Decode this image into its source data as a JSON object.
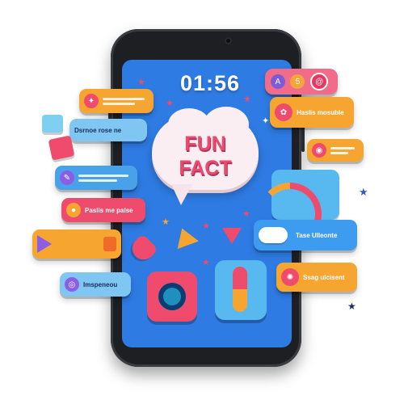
{
  "clock": {
    "time": "01:56"
  },
  "speech_cloud": {
    "line1": "FUN",
    "line2": "FACT"
  },
  "bubbles": {
    "left_top": "",
    "left_2": "Dsrnoe rose ne",
    "left_3": "",
    "left_4": "Paslis me palse",
    "left_5": "",
    "left_6": "Imspeneou",
    "right_top": "",
    "right_2": "Haslis mosuble",
    "right_3": "",
    "right_4": "Tase Ulleonte",
    "right_5": "Ssag ulcisent"
  },
  "colors": {
    "screen": "#2e7be3",
    "accent_pink": "#ef4b6c",
    "accent_orange": "#f7a531",
    "accent_blue": "#48a2ea"
  },
  "icons": [
    "lightbulb-icon",
    "chat-icon",
    "heart-icon",
    "rainbow-icon",
    "cloud-icon",
    "star-icon",
    "pill-icon",
    "camera-app-icon"
  ]
}
